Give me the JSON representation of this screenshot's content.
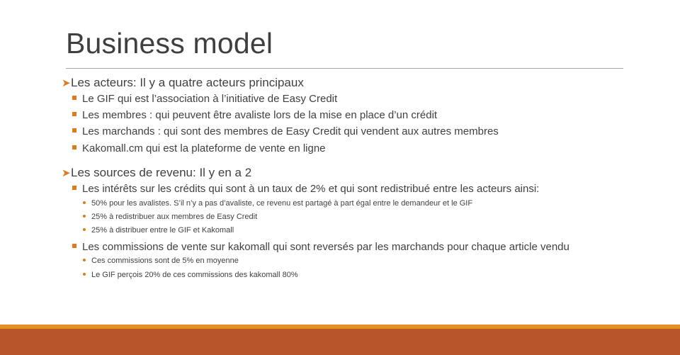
{
  "slide": {
    "title": "Business model",
    "sections": [
      {
        "label": "Les acteurs: Il y a quatre acteurs principaux",
        "items": [
          "Le GIF qui est l’association à l’initiative de Easy Credit",
          "Les membres : qui peuvent être avaliste lors de la mise en place d’un crédit",
          "Les marchands : qui sont des membres de Easy Credit qui vendent aux autres membres",
          "Kakomall.cm qui est la plateforme de vente en ligne"
        ]
      },
      {
        "label": "Les sources de revenu: Il y en a 2",
        "items": [
          {
            "text": "Les intérêts sur les crédits qui sont à un taux de 2% et qui sont redistribué entre les acteurs ainsi:",
            "subitems": [
              "50% pour les avalistes. S’il n’y a pas d’avaliste, ce revenu est partagé à part égal entre le demandeur et le GIF",
              "25% à redistribuer aux membres de Easy Credit",
              "25% à distribuer entre le GIF et Kakomall"
            ]
          },
          {
            "text": "Les commissions de vente sur kakomall qui sont reversés par les marchands pour chaque article vendu",
            "subitems": [
              "Ces commissions sont de 5% en moyenne",
              "Le GIF perçois 20% de ces commissions des kakomall 80%"
            ]
          }
        ]
      }
    ]
  },
  "colors": {
    "accent": "#e07a1f",
    "footer_top": "#e58f23",
    "footer_band": "#b9552b",
    "text": "#404040"
  },
  "icons": {
    "level1_bullet": "arrow-bullet-icon",
    "level2_bullet": "square-bullet-icon",
    "level3_bullet": "dot-bullet-icon"
  }
}
